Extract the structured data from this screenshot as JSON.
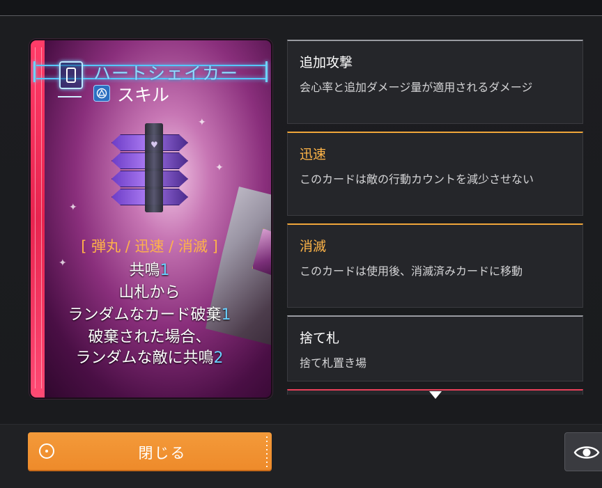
{
  "card": {
    "title": "ハートシェイカー",
    "type_label": "スキル",
    "keywords": "[ 弾丸 / 迅速 / 消滅 ]",
    "effect": {
      "line1_text": "共鳴",
      "line1_num": "1",
      "line2_text": "山札から",
      "line3_text": "ランダムなカード破棄",
      "line3_num": "1",
      "line4_text": "破棄された場合、",
      "line5_text": "ランダムな敵に共鳴",
      "line5_num": "2"
    },
    "cost_icon": "card-cost-icon",
    "type_icon": "skill-icon"
  },
  "keyword_panels": [
    {
      "title": "追加攻撃",
      "desc": "会心率と追加ダメージ量が適用されるダメージ"
    },
    {
      "title": "迅速",
      "desc": "このカードは敵の行動カウントを減少させない"
    },
    {
      "title": "消滅",
      "desc": "このカードは使用後、消滅済みカードに移動"
    },
    {
      "title": "捨て札",
      "desc": "捨て札置き場"
    }
  ],
  "buttons": {
    "close_label": "閉じる",
    "close_icon": "target-icon",
    "view_icon": "eye-icon"
  },
  "colors": {
    "accent_orange": "#f0a63a",
    "button_orange": "#f39a3a",
    "card_stripe": "#e8244f",
    "title_blue": "#8fdcff",
    "number_blue": "#6ad0ff"
  }
}
